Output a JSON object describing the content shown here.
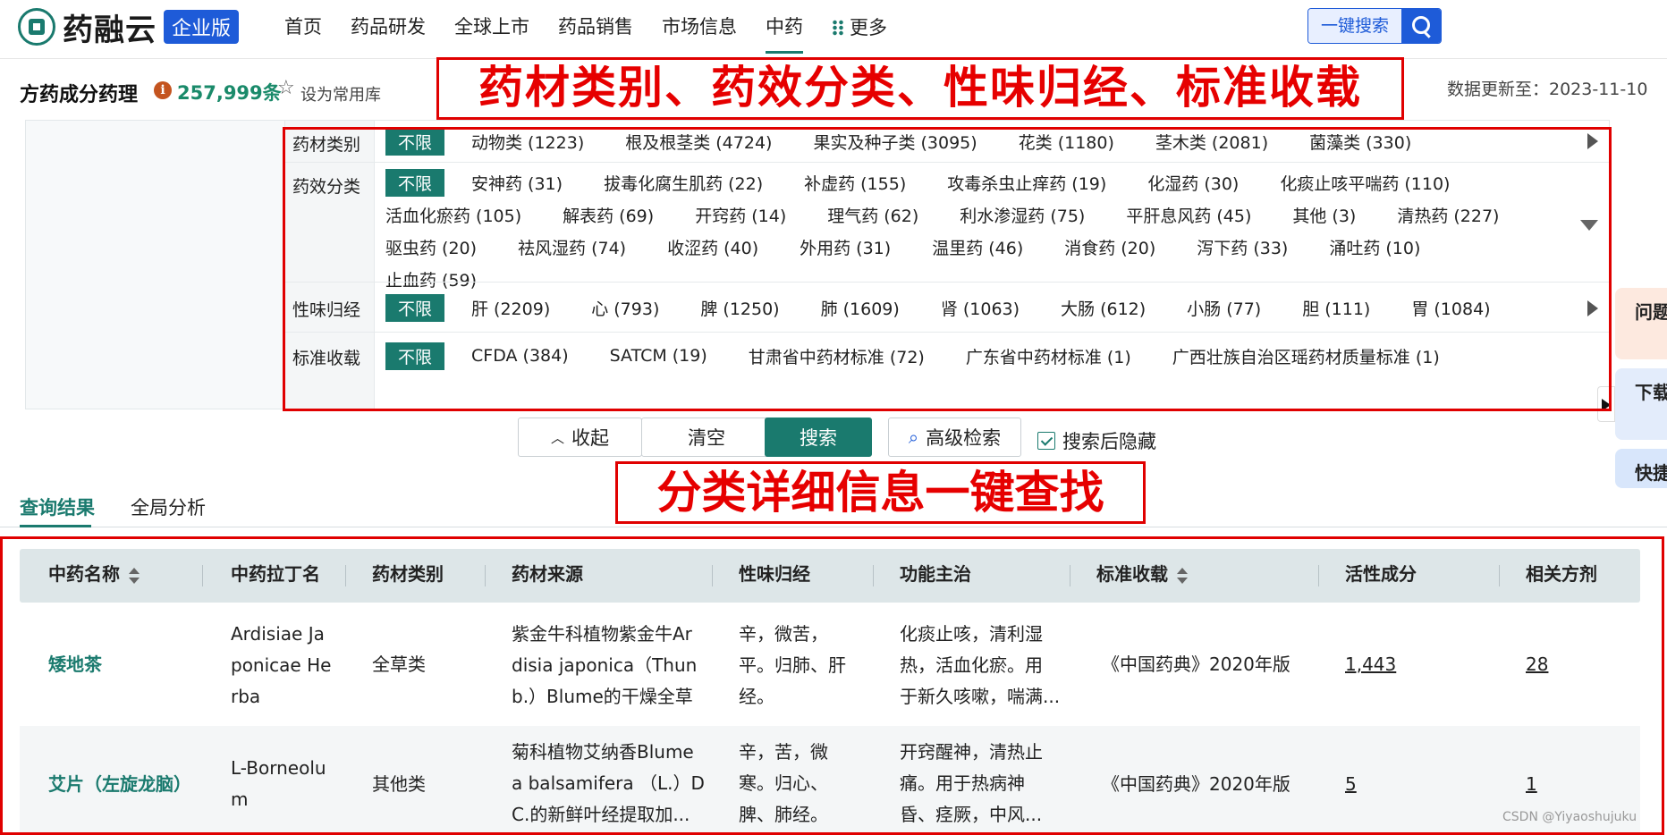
{
  "brand": {
    "name": "药融云",
    "badge": "企业版"
  },
  "nav": {
    "items": [
      "首页",
      "药品研发",
      "全球上市",
      "药品销售",
      "市场信息",
      "中药"
    ],
    "more": "更多",
    "active": "中药"
  },
  "search": {
    "label": "一键搜索"
  },
  "page": {
    "title": "方药成分药理",
    "count": "257,999条",
    "set_common": "设为常用库",
    "update_label": "数据更新至：2023-11-10"
  },
  "annotations": {
    "top": "药材类别、药效分类、性味归经、标准收载",
    "middle": "分类详细信息一键查找"
  },
  "filters": [
    {
      "label": "药材类别",
      "lines": [
        [
          "不限",
          "动物类 (1223)",
          "根及根茎类 (4724)",
          "果实及种子类 (3095)",
          "花类 (1180)",
          "茎木类 (2081)",
          "菌藻类 (330)"
        ]
      ]
    },
    {
      "label": "药效分类",
      "lines": [
        [
          "不限",
          "安神药 (31)",
          "拔毒化腐生肌药 (22)",
          "补虚药 (155)",
          "攻毒杀虫止痒药 (19)",
          "化湿药 (30)",
          "化痰止咳平喘药 (110)"
        ],
        [
          "活血化瘀药 (105)",
          "解表药 (69)",
          "开窍药 (14)",
          "理气药 (62)",
          "利水渗湿药 (75)",
          "平肝息风药 (45)",
          "其他 (3)",
          "清热药 (227)"
        ],
        [
          "驱虫药 (20)",
          "祛风湿药 (74)",
          "收涩药 (40)",
          "外用药 (31)",
          "温里药 (46)",
          "消食药 (20)",
          "泻下药 (33)",
          "涌吐药 (10)"
        ],
        [
          "止血药 (59)"
        ]
      ]
    },
    {
      "label": "性味归经",
      "lines": [
        [
          "不限",
          "肝 (2209)",
          "心 (793)",
          "脾 (1250)",
          "肺 (1609)",
          "肾 (1063)",
          "大肠 (612)",
          "小肠 (77)",
          "胆 (111)",
          "胃 (1084)"
        ]
      ]
    },
    {
      "label": "标准收载",
      "lines": [
        [
          "不限",
          "CFDA (384)",
          "SATCM (19)",
          "甘肃省中药材标准 (72)",
          "广东省中药材标准 (1)",
          "广西壮族自治区瑶药材质量标准 (1)"
        ]
      ]
    }
  ],
  "buttons": {
    "collapse": "收起",
    "clear": "清空",
    "search": "搜索",
    "advanced": "高级检索",
    "hide_after_search": "搜索后隐藏"
  },
  "tabs": [
    "查询结果",
    "全局分析"
  ],
  "table": {
    "columns": [
      "中药名称",
      "中药拉丁名",
      "药材类别",
      "药材来源",
      "性味归经",
      "功能主治",
      "标准收载",
      "活性成分",
      "相关方剂"
    ],
    "rows": [
      {
        "name": "矮地茶",
        "latin": [
          "Ardisiae Ja",
          "ponicae He",
          "rba"
        ],
        "category": "全草类",
        "source": [
          "紫金牛科植物紫金牛Ar",
          "disia japonica（Thun",
          "b.）Blume的干燥全草"
        ],
        "nature": [
          "辛，微苦，",
          "平。归肺、肝",
          "经。"
        ],
        "function": [
          "化痰止咳，清利湿",
          "热，活血化瘀。用",
          "于新久咳嗽，喘满..."
        ],
        "standard": "《中国药典》2020年版",
        "active": "1,443",
        "related": "28"
      },
      {
        "name": "艾片（左旋龙脑）",
        "latin": [
          "L-Borneolu",
          "m"
        ],
        "category": "其他类",
        "source": [
          "菊科植物艾纳香Blume",
          "a balsamifera （L.）D",
          "C.的新鲜叶经提取加..."
        ],
        "nature": [
          "辛，苦，微",
          "寒。归心、",
          "脾、肺经。"
        ],
        "function": [
          "开窍醒神，清热止",
          "痛。用于热病神",
          "昏、痉厥，中风..."
        ],
        "standard": "《中国药典》2020年版",
        "active": "5",
        "related": "1"
      }
    ]
  },
  "side_panel": [
    "问题反馈",
    "下载记录",
    "快捷"
  ],
  "watermark": "CSDN @Yiyaoshujuku",
  "colors": {
    "accent": "#1a7a6e",
    "brand_blue": "#1e5bd8",
    "annotation_red": "#e00000"
  }
}
